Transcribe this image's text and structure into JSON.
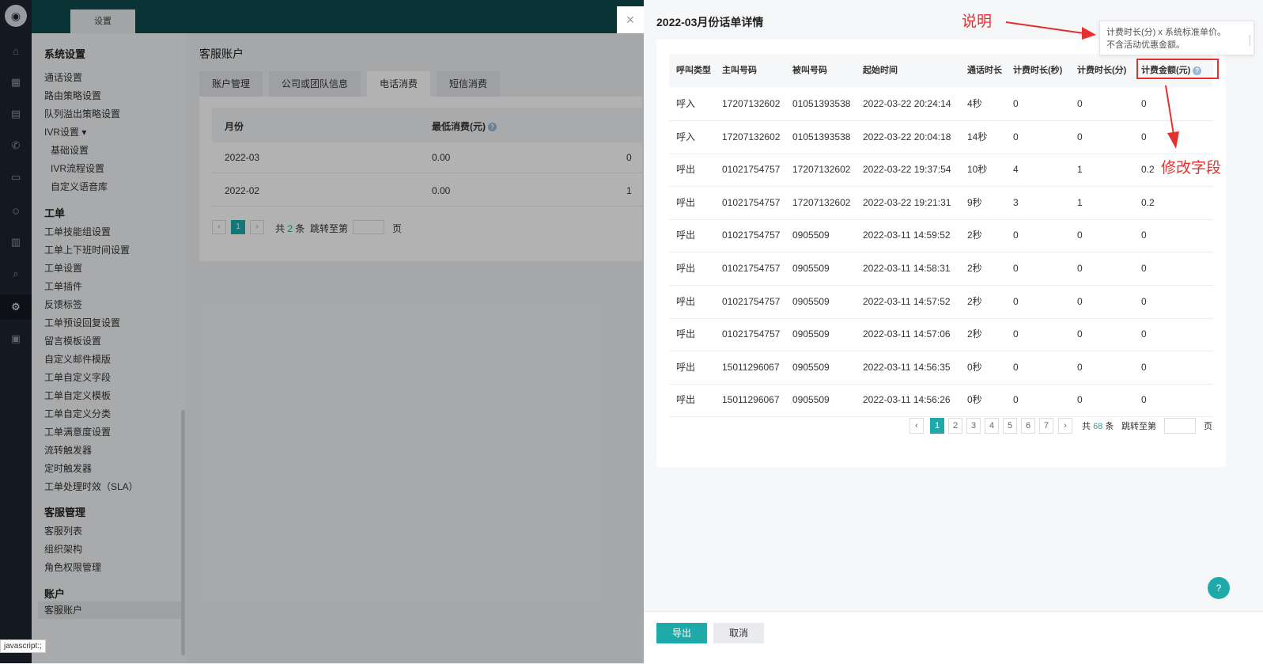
{
  "header": {
    "tab_label": "设置"
  },
  "menu": {
    "title": "系统设置",
    "items1": [
      "通话设置",
      "路由策略设置",
      "队列溢出策略设置",
      "IVR设置 ▾"
    ],
    "ivr_sub": [
      "基础设置",
      "IVR流程设置",
      "自定义语音库"
    ],
    "section_ticket": "工单",
    "ticket_items": [
      "工单技能组设置",
      "工单上下班时间设置",
      "工单设置",
      "工单插件",
      "反馈标签",
      "工单预设回复设置",
      "留言模板设置",
      "自定义邮件模版",
      "工单自定义字段",
      "工单自定义模板",
      "工单自定义分类",
      "工单满意度设置",
      "流转触发器",
      "定时触发器",
      "工单处理时效（SLA）"
    ],
    "section_agent": "客服管理",
    "agent_items": [
      "客服列表",
      "组织架构",
      "角色权限管理"
    ],
    "section_account": "账户",
    "account_items": [
      "客服账户"
    ]
  },
  "main": {
    "title": "客服账户",
    "tabs": [
      "账户管理",
      "公司或团队信息",
      "电话消费",
      "短信消费"
    ],
    "table": {
      "headers": [
        "月份",
        "最低消费(元)"
      ],
      "rows": [
        {
          "month": "2022-03",
          "min": "0.00",
          "extra": "0"
        },
        {
          "month": "2022-02",
          "min": "0.00",
          "extra": "1"
        }
      ]
    },
    "pagination": {
      "prev": "‹",
      "page": "1",
      "next": "›",
      "total_prefix": "共",
      "total": "2",
      "total_suffix": "条",
      "jump": "跳转至第",
      "page_suffix": "页"
    }
  },
  "drawer": {
    "close": "×",
    "title": "2022-03月份话单详情",
    "headers": [
      "呼叫类型",
      "主叫号码",
      "被叫号码",
      "起始时间",
      "通话时长",
      "计费时长(秒)",
      "计费时长(分)",
      "计费金额(元)"
    ],
    "help_glyph": "?",
    "rows": [
      [
        "呼入",
        "17207132602",
        "01051393538",
        "2022-03-22 20:24:14",
        "4秒",
        "0",
        "0",
        "0"
      ],
      [
        "呼入",
        "17207132602",
        "01051393538",
        "2022-03-22 20:04:18",
        "14秒",
        "0",
        "0",
        "0"
      ],
      [
        "呼出",
        "01021754757",
        "17207132602",
        "2022-03-22 19:37:54",
        "10秒",
        "4",
        "1",
        "0.2"
      ],
      [
        "呼出",
        "01021754757",
        "17207132602",
        "2022-03-22 19:21:31",
        "9秒",
        "3",
        "1",
        "0.2"
      ],
      [
        "呼出",
        "01021754757",
        "0905509",
        "2022-03-11 14:59:52",
        "2秒",
        "0",
        "0",
        "0"
      ],
      [
        "呼出",
        "01021754757",
        "0905509",
        "2022-03-11 14:58:31",
        "2秒",
        "0",
        "0",
        "0"
      ],
      [
        "呼出",
        "01021754757",
        "0905509",
        "2022-03-11 14:57:52",
        "2秒",
        "0",
        "0",
        "0"
      ],
      [
        "呼出",
        "01021754757",
        "0905509",
        "2022-03-11 14:57:06",
        "2秒",
        "0",
        "0",
        "0"
      ],
      [
        "呼出",
        "15011296067",
        "0905509",
        "2022-03-11 14:56:35",
        "0秒",
        "0",
        "0",
        "0"
      ],
      [
        "呼出",
        "15011296067",
        "0905509",
        "2022-03-11 14:56:26",
        "0秒",
        "0",
        "0",
        "0"
      ]
    ],
    "pagination": {
      "prev": "‹",
      "pages": [
        "1",
        "2",
        "3",
        "4",
        "5",
        "6",
        "7"
      ],
      "next": "›",
      "total_prefix": "共",
      "total": "68",
      "total_suffix": "条",
      "jump": "跳转至第",
      "page_suffix": "页"
    },
    "tooltip": {
      "line1": "计费时长(分) x 系统标准单价。",
      "line2": "不含活动优惠金额。"
    },
    "annotations": {
      "explain": "说明",
      "modify": "修改字段",
      "color": "#e53030"
    },
    "footer": {
      "export": "导出",
      "cancel": "取消"
    },
    "fab_icon": "?"
  },
  "statusbar": "javascript:;",
  "colors": {
    "accent": "#1eaaa9",
    "header": "#0f4a4c",
    "rail": "#1d2330"
  }
}
